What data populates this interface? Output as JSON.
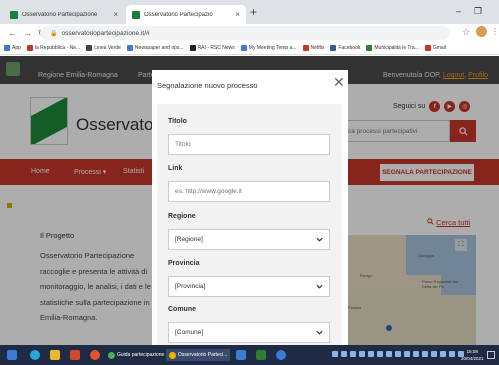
{
  "browser": {
    "tabs": [
      {
        "label": "Osservatorio Partecipazione",
        "close": "×"
      },
      {
        "label": "Osservatorio Partecipazio",
        "close": "×"
      }
    ],
    "new_tab": "+",
    "win_min": "–",
    "win_max": "❐",
    "url": "osservatoriopartecipazione.it/#",
    "bookmarks": [
      {
        "label": "App",
        "color": "#3c78d8"
      },
      {
        "label": "la Repubblica - Ne...",
        "color": "#c8352a"
      },
      {
        "label": "Linea Verde",
        "color": "#444"
      },
      {
        "label": "Newspaper and ops...",
        "color": "#3c78d8"
      },
      {
        "label": "RAI - RSC News",
        "color": "#222"
      },
      {
        "label": "My Meeting Temp a...",
        "color": "#3c78d8"
      },
      {
        "label": "Netflix",
        "color": "#c8352a"
      },
      {
        "label": "Facebook",
        "color": "#3b5998"
      },
      {
        "label": "Municipalità le Tra...",
        "color": "#2e7d32"
      },
      {
        "label": "Gmail",
        "color": "#c8352a"
      }
    ]
  },
  "site": {
    "top": {
      "region": "Regione Emilia-Romagna",
      "parte": "Parte",
      "welcome": "Benvenuto/a OOP,",
      "logout": "Logout",
      "profile": "Profilo"
    },
    "header": {
      "logo_text": "Osservatorio",
      "seguici": "Seguici su",
      "search_placeholder": "ca processi partecipativi"
    },
    "nav": {
      "home": "Home",
      "processi": "Processi ▾",
      "statistiche": "Statisti",
      "cta": "SEGNALA PARTECIPAZIONE"
    },
    "content": {
      "title": "Il Progetto",
      "text": "Osservatorio Partecipazione raccoglie e presenta le attività di monitoraggio, le analisi, i dati e le statistiche sulla partecipazione in Emilia-Romagna.",
      "cerca": "Cerca tutti",
      "map_labels": [
        "Chioggia",
        "Rovigo",
        "Parco Regionale del Delta del Po",
        "Ferrara"
      ]
    }
  },
  "modal": {
    "title": "Segnalazione nuovo processo",
    "close": "✕",
    "fields": {
      "titolo_label": "Titolo",
      "titolo_placeholder": "Titolo",
      "link_label": "Link",
      "link_placeholder": "es. http://www.google.it",
      "regione_label": "Regione",
      "regione_value": "[Regione]",
      "provincia_label": "Provincia",
      "provincia_value": "[Provincia]",
      "comune_label": "Comune",
      "comune_value": "[Comune]"
    }
  },
  "taskbar": {
    "apps": [
      "Guida partecipazione",
      "Osservatorio Parteci..."
    ],
    "time": "15:08",
    "date": "20/04/2021"
  },
  "colors": {
    "brand_red": "#c8352a",
    "brand_green": "#1c8a3a",
    "taskbar": "#1f2a44"
  }
}
